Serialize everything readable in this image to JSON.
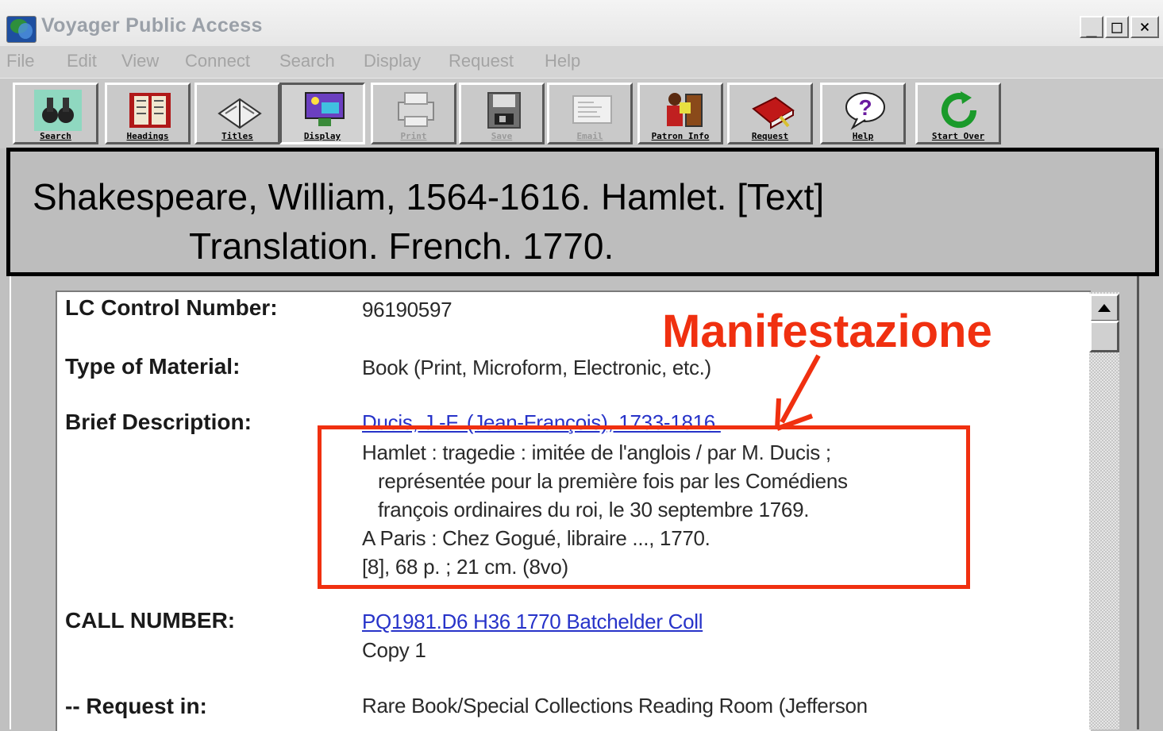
{
  "window": {
    "title": "Voyager Public Access"
  },
  "menu": [
    "File",
    "Edit",
    "View",
    "Connect",
    "Search",
    "Display",
    "Request",
    "Help"
  ],
  "toolbar": [
    {
      "label": "Search",
      "icon": "binoculars-icon",
      "state": "normal"
    },
    {
      "label": "Headings",
      "icon": "card-catalog-icon",
      "state": "normal"
    },
    {
      "label": "Titles",
      "icon": "open-book-icon",
      "state": "normal"
    },
    {
      "label": "Display",
      "icon": "display-screen-icon",
      "state": "pressed"
    },
    {
      "label": "Print",
      "icon": "printer-icon",
      "state": "disabled"
    },
    {
      "label": "Save",
      "icon": "floppy-disk-icon",
      "state": "disabled"
    },
    {
      "label": "Email",
      "icon": "email-icon",
      "state": "disabled"
    },
    {
      "label": "Patron Info",
      "icon": "patron-icon",
      "state": "normal"
    },
    {
      "label": "Request",
      "icon": "book-request-icon",
      "state": "normal"
    },
    {
      "label": "Help",
      "icon": "help-icon",
      "state": "normal"
    },
    {
      "label": "Start Over",
      "icon": "start-over-icon",
      "state": "normal"
    }
  ],
  "banner": {
    "line1": "Shakespeare, William, 1564-1616.  Hamlet. [Text]",
    "line2": "Translation.  French.  1770."
  },
  "annotation": {
    "text": "Manifestazione",
    "color": "#f03010"
  },
  "record": {
    "lccn_label": "LC Control Number:",
    "lccn_value": "96190597",
    "type_label": "Type of Material:",
    "type_value": "Book (Print, Microform, Electronic, etc.)",
    "brief_label": "Brief Description:",
    "brief_author_link": "Ducis, J.-F. (Jean-François), 1733-1816.",
    "brief_lines": [
      "Hamlet : tragedie : imitée de l'anglois / par M. Ducis ;",
      "représentée pour la première fois par les Comédiens",
      "françois ordinaires du roi, le 30 septembre 1769.",
      "A Paris : Chez Gogué, libraire ..., 1770.",
      "[8], 68 p. ; 21 cm. (8vo)"
    ],
    "call_label": "CALL NUMBER:",
    "call_link": "PQ1981.D6 H36 1770 Batchelder Coll",
    "call_copy": "Copy 1",
    "request_label": "-- Request in:",
    "request_value": "Rare Book/Special Collections Reading Room (Jefferson"
  }
}
